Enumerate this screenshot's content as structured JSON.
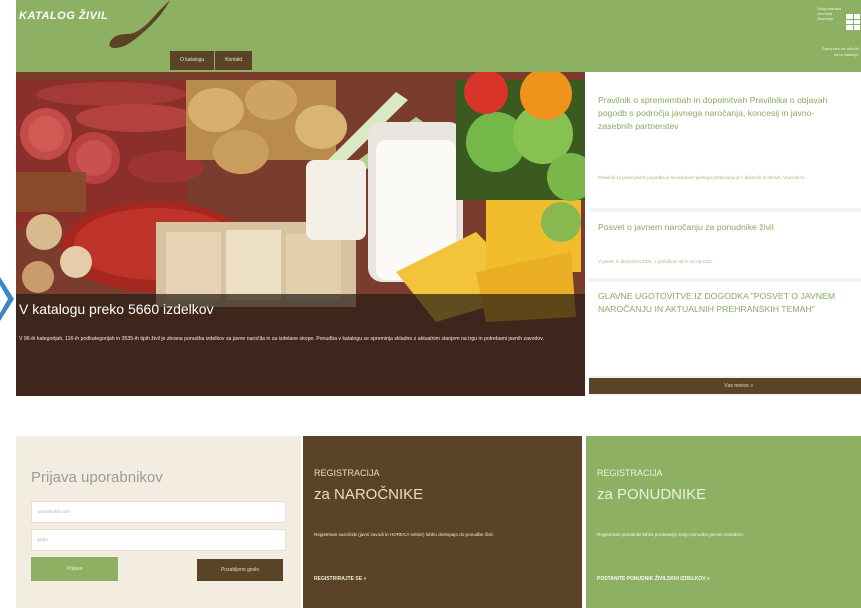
{
  "header": {
    "logo_text": "KATALOG ŽIVIL",
    "nav": [
      "O katalogu",
      "Kontakt"
    ],
    "ministry_text": "Gospodarska zbornica Slovenije",
    "ministry_link": "Zakaj smo se odločili za ta katalog?"
  },
  "hero": {
    "title": "V katalogu preko 5660 izdelkov",
    "description": "V 96-ih kategorijah, 116-ih podkategorijah in 3535-ih tipih živil je zbrana ponudba izdelkov za javne naročila in za izdelane skope. Ponudba v katalogu se spreminja skladno z aktualnim stanjem na trgu in potrebami javnih zavodov."
  },
  "news": {
    "items": [
      {
        "title": "Pravilnik o spremembah in dopolnitvah Pravilnika o objavah pogodb s področja javnega naročanja, koncesij in javno-zasebnih partnerstev",
        "meta": "Pravilnik za javne javnih pogodba je na uradnem javnega prekrivanju je v delovnih in dnevih. Vnosnik to..."
      },
      {
        "title": "Posvet o javnem naročanju za ponudnike živil",
        "meta": "V petek, 3. decembra 2021, z pričetkom ob 9. uri na GZS"
      },
      {
        "title": "GLAVNE UGOTOVITVE IZ DOGODKA \"POSVET O JAVNEM NAROČANJU IN AKTUALNIH PREHRANSKIH TEMAH\"",
        "meta": ""
      }
    ],
    "more_label": "Vse novice »"
  },
  "login": {
    "title": "Prijava uporabnikov",
    "username_placeholder": "uporabniško ime",
    "password_placeholder": "geslo",
    "login_label": "Prijava",
    "forgot_label": "Pozabljeno geslo"
  },
  "reg_buyers": {
    "small": "REGISTRACIJA",
    "big": "za NAROČNIKE",
    "desc": "Registrirani naročniki (javni zavodi in HORECA sektor) lahko dostopajo do ponudbe živil.",
    "cta": "REGISTRIRAJTE SE »"
  },
  "reg_sellers": {
    "small": "REGISTRACIJA",
    "big": "za PONUDNIKE",
    "desc": "Registrirani ponudniki lahko predstavijo svojo ponudbo javnim zavodom.",
    "cta": "POSTANITE PONUDNIK ŽIVILSKIH IZDELKOV »"
  },
  "colors": {
    "green": "#8db062",
    "brown": "#5a4326",
    "cream": "#f3ede1",
    "news_text": "#8aaa62"
  }
}
